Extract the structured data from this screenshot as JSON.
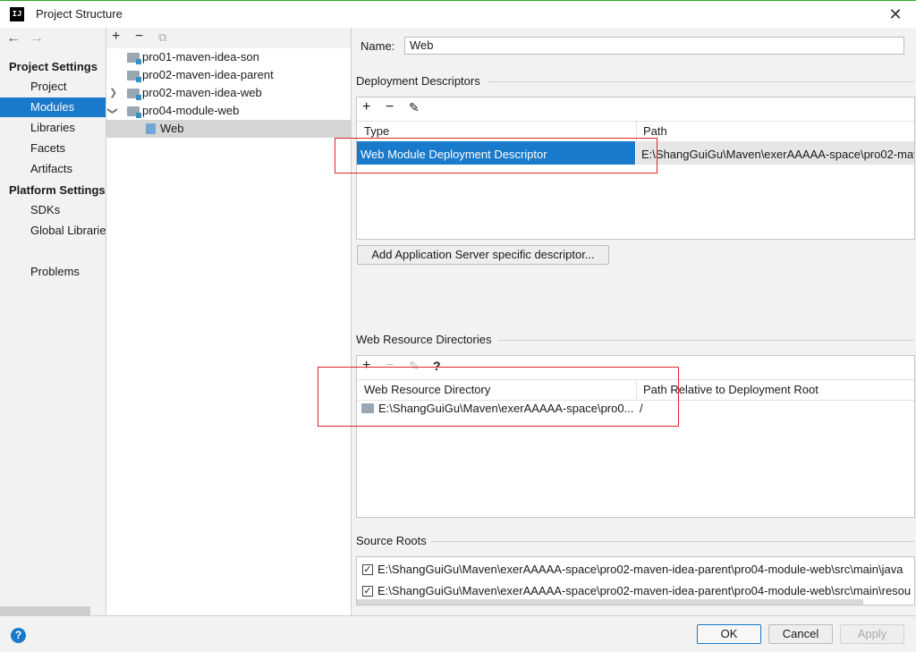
{
  "window": {
    "title": "Project Structure",
    "app_icon_text": "IJ"
  },
  "nav": {
    "back": "←",
    "forward": "→",
    "project_settings": "Project Settings",
    "project_items": [
      "Project",
      "Modules",
      "Libraries",
      "Facets",
      "Artifacts"
    ],
    "platform_settings": "Platform Settings",
    "platform_items": [
      "SDKs",
      "Global Libraries"
    ],
    "problems": "Problems",
    "selected": "Modules"
  },
  "tree": {
    "toolbar": {
      "add": "+",
      "remove": "−",
      "copy": "⧉"
    },
    "nodes": [
      "pro01-maven-idea-son",
      "pro02-maven-idea-parent",
      "pro02-maven-idea-web",
      "pro04-module-web",
      "Web"
    ],
    "selected": "Web"
  },
  "facet": {
    "name_label": "Name:",
    "name_value": "Web",
    "deployment_descriptors": {
      "section_title": "Deployment Descriptors",
      "columns": [
        "Type",
        "Path"
      ],
      "row": {
        "type": "Web Module Deployment Descriptor",
        "path": "E:\\ShangGuiGu\\Maven\\exerAAAAA-space\\pro02-mav"
      }
    },
    "add_server_button": "Add Application Server specific descriptor...",
    "web_resource_dirs": {
      "section_title": "Web Resource Directories",
      "help": "?",
      "columns": [
        "Web Resource Directory",
        "Path Relative to Deployment Root"
      ],
      "row": {
        "directory": "E:\\ShangGuiGu\\Maven\\exerAAAAA-space\\pro0...",
        "relative": "/"
      }
    },
    "source_roots": {
      "section_title": "Source Roots",
      "items": [
        "E:\\ShangGuiGu\\Maven\\exerAAAAA-space\\pro02-maven-idea-parent\\pro04-module-web\\src\\main\\java",
        "E:\\ShangGuiGu\\Maven\\exerAAAAA-space\\pro02-maven-idea-parent\\pro04-module-web\\src\\main\\resou"
      ]
    }
  },
  "footer": {
    "help": "?",
    "ok": "OK",
    "cancel": "Cancel",
    "apply": "Apply"
  },
  "colors": {
    "selection": "#1979ca",
    "highlight": "#e0242b",
    "accent": "#2aa82a"
  }
}
